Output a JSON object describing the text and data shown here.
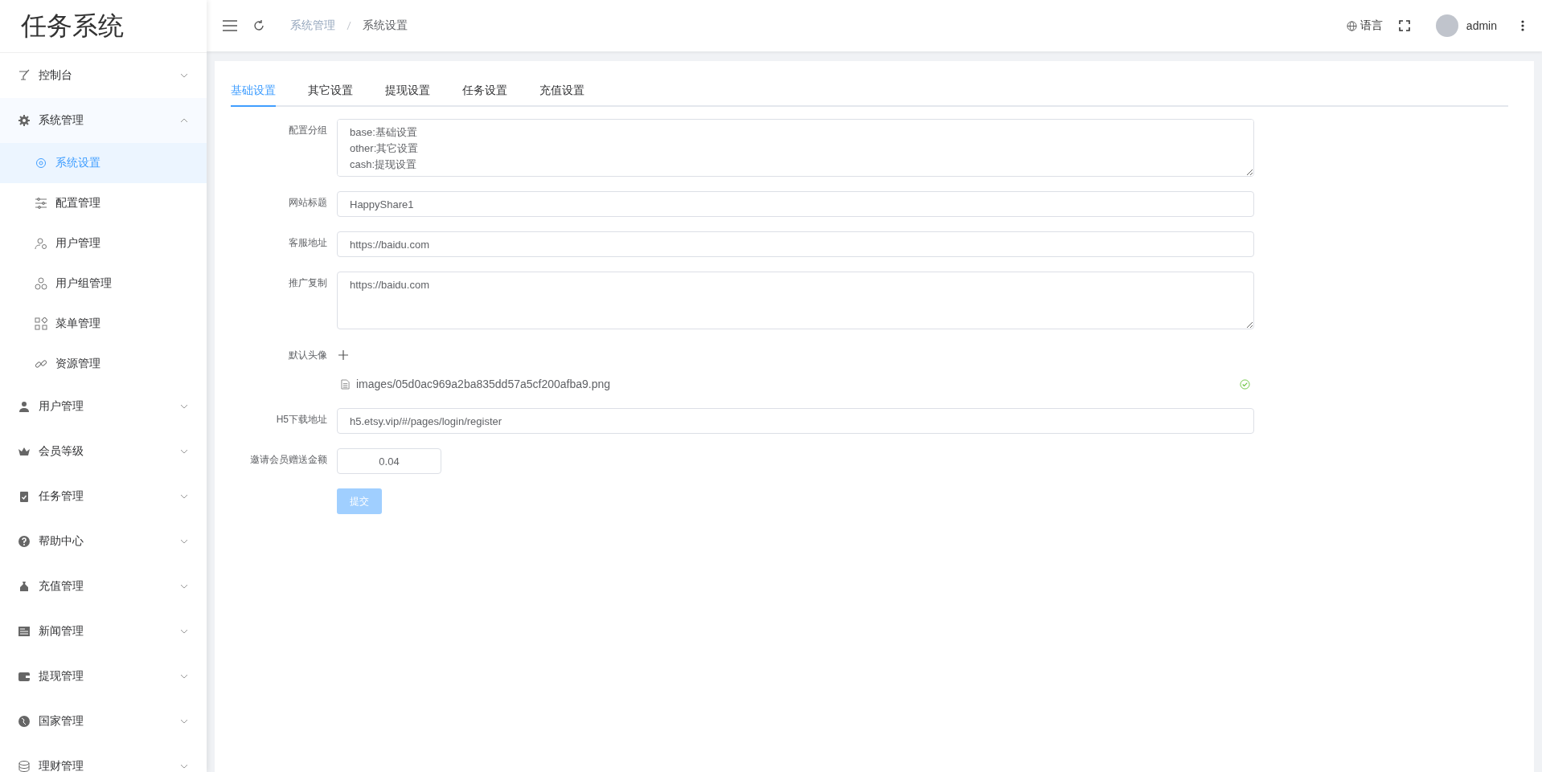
{
  "logo": "任务系统",
  "sidebar": {
    "items": [
      {
        "label": "控制台",
        "expanded": false
      },
      {
        "label": "系统管理",
        "expanded": true,
        "children": [
          {
            "label": "系统设置",
            "selected": true
          },
          {
            "label": "配置管理",
            "selected": false
          },
          {
            "label": "用户管理",
            "selected": false
          },
          {
            "label": "用户组管理",
            "selected": false
          },
          {
            "label": "菜单管理",
            "selected": false
          },
          {
            "label": "资源管理",
            "selected": false
          }
        ]
      },
      {
        "label": "用户管理",
        "expanded": false
      },
      {
        "label": "会员等级",
        "expanded": false
      },
      {
        "label": "任务管理",
        "expanded": false
      },
      {
        "label": "帮助中心",
        "expanded": false
      },
      {
        "label": "充值管理",
        "expanded": false
      },
      {
        "label": "新闻管理",
        "expanded": false
      },
      {
        "label": "提现管理",
        "expanded": false
      },
      {
        "label": "国家管理",
        "expanded": false
      },
      {
        "label": "理财管理",
        "expanded": false
      }
    ]
  },
  "header": {
    "breadcrumb": [
      "系统管理",
      "系统设置"
    ],
    "language": "语言",
    "user": "admin"
  },
  "tabs": [
    {
      "label": "基础设置",
      "selected": true
    },
    {
      "label": "其它设置",
      "selected": false
    },
    {
      "label": "提现设置",
      "selected": false
    },
    {
      "label": "任务设置",
      "selected": false
    },
    {
      "label": "充值设置",
      "selected": false
    }
  ],
  "form": {
    "fields": [
      {
        "kind": "textarea",
        "label": "配置分组",
        "value": "base:基础设置\nother:其它设置\ncash:提现设置"
      },
      {
        "kind": "input",
        "label": "网站标题",
        "value": "HappyShare1"
      },
      {
        "kind": "input",
        "label": "客服地址",
        "value": "https://baidu.com"
      },
      {
        "kind": "textarea",
        "label": "推广复制",
        "value": "https://baidu.com"
      },
      {
        "kind": "upload",
        "label": "默认头像",
        "files": [
          {
            "name": "images/05d0ac969a2ba835dd57a5cf200afba9.png",
            "uploaded": true
          }
        ]
      },
      {
        "kind": "input",
        "label": "H5下载地址",
        "value": "h5.etsy.vip/#/pages/login/register"
      },
      {
        "kind": "number",
        "label": "邀请会员赠送金额",
        "value": "0.04"
      }
    ],
    "submit": {
      "label": "提交",
      "disabled": true
    }
  }
}
